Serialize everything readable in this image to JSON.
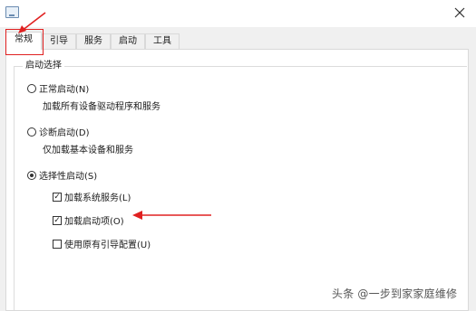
{
  "tabs": [
    {
      "label": "常规",
      "active": true
    },
    {
      "label": "引导",
      "active": false
    },
    {
      "label": "服务",
      "active": false
    },
    {
      "label": "启动",
      "active": false
    },
    {
      "label": "工具",
      "active": false
    }
  ],
  "startup_group": {
    "label": "启动选择",
    "normal": {
      "label": "正常启动(N)",
      "desc": "加载所有设备驱动程序和服务",
      "selected": false
    },
    "diagnostic": {
      "label": "诊断启动(D)",
      "desc": "仅加载基本设备和服务",
      "selected": false
    },
    "selective": {
      "label": "选择性启动(S)",
      "selected": true,
      "options": [
        {
          "label": "加载系统服务(L)",
          "checked": true
        },
        {
          "label": "加载启动项(O)",
          "checked": true
        },
        {
          "label": "使用原有引导配置(U)",
          "checked": false
        }
      ]
    }
  },
  "watermark": "头条 @一步到家家庭维修",
  "colors": {
    "annotation": "#e02020",
    "panel_bg": "#ffffff",
    "window_bg": "#f0f0f0"
  },
  "icons": {
    "app": "msconfig-window-icon",
    "close": "close-icon"
  }
}
